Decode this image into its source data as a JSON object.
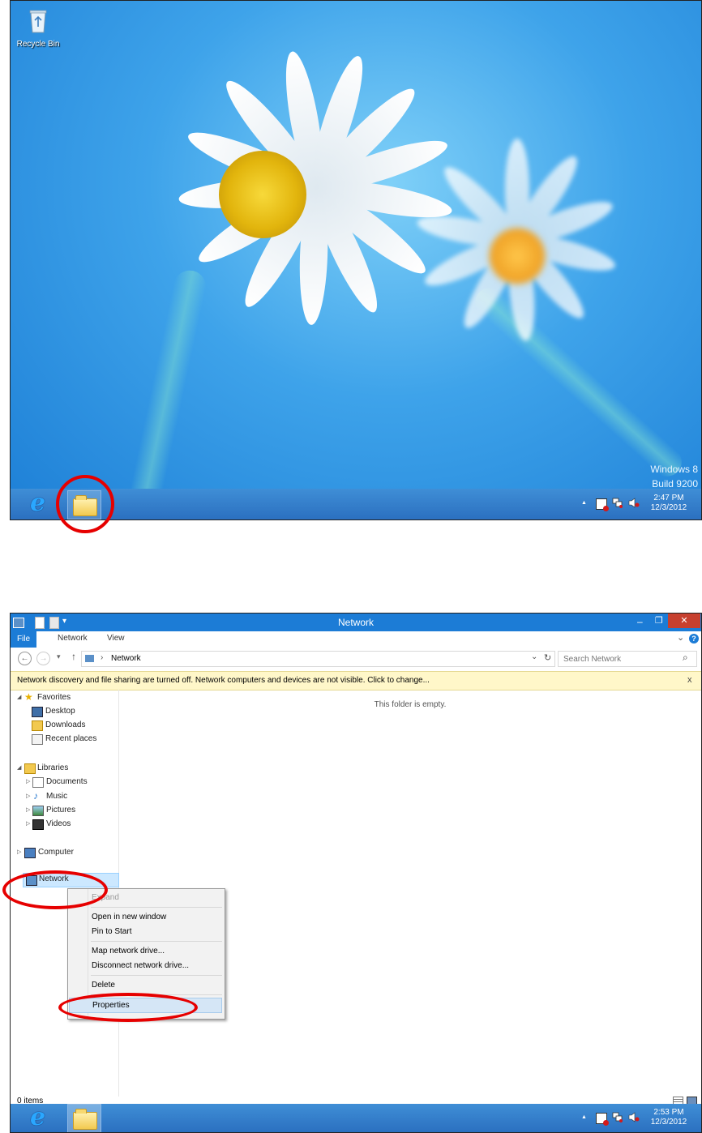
{
  "desktop": {
    "recycle_bin_label": "Recycle Bin",
    "watermark_line1": "Windows 8",
    "watermark_line2": "Build 9200",
    "tray_time": "2:47 PM",
    "tray_date": "12/3/2012",
    "tray_overflow": "▲",
    "icons": [
      "recycle-bin-icon",
      "internet-explorer-icon",
      "file-explorer-icon",
      "action-center-flag-icon",
      "network-tray-icon",
      "volume-muted-icon"
    ]
  },
  "explorer": {
    "window_title": "Network",
    "qat_dropdown": "▾",
    "window_buttons": {
      "minimize": "–",
      "restore": "❐",
      "close": "✕"
    },
    "tabs": [
      {
        "label": "File"
      },
      {
        "label": "Network"
      },
      {
        "label": "View"
      }
    ],
    "ribbon_expand": "⌄",
    "help": "?",
    "address": {
      "back": "←",
      "forward": "→",
      "recent": "▾",
      "up": "↑",
      "separator": "›",
      "path": "Network",
      "dropdown": "⌄",
      "refresh": "↻"
    },
    "search": {
      "placeholder": "Search Network",
      "icon": "⌕"
    },
    "infobar": {
      "text": "Network discovery and file sharing are turned off. Network computers and devices are not visible. Click to change...",
      "close": "x"
    },
    "empty_message": "This folder is empty.",
    "nav": {
      "favorites": {
        "label": "Favorites",
        "items": [
          "Desktop",
          "Downloads",
          "Recent places"
        ]
      },
      "libraries": {
        "label": "Libraries",
        "items": [
          "Documents",
          "Music",
          "Pictures",
          "Videos"
        ]
      },
      "computer": "Computer",
      "network": "Network"
    },
    "context_menu": {
      "expand": "Expand",
      "open_new_window": "Open in new window",
      "pin_to_start": "Pin to Start",
      "map_drive": "Map network drive...",
      "disconnect_drive": "Disconnect network drive...",
      "delete": "Delete",
      "properties": "Properties"
    },
    "status": {
      "items": "0 items"
    },
    "tray_time": "2:53 PM",
    "tray_date": "12/3/2012",
    "tray_overflow": "▲"
  },
  "colors": {
    "accent": "#1c7cd6",
    "taskbar": "#2b70c0",
    "highlight_circle": "#e60000",
    "infobar": "#fff7c9",
    "selection": "#cce8ff"
  }
}
